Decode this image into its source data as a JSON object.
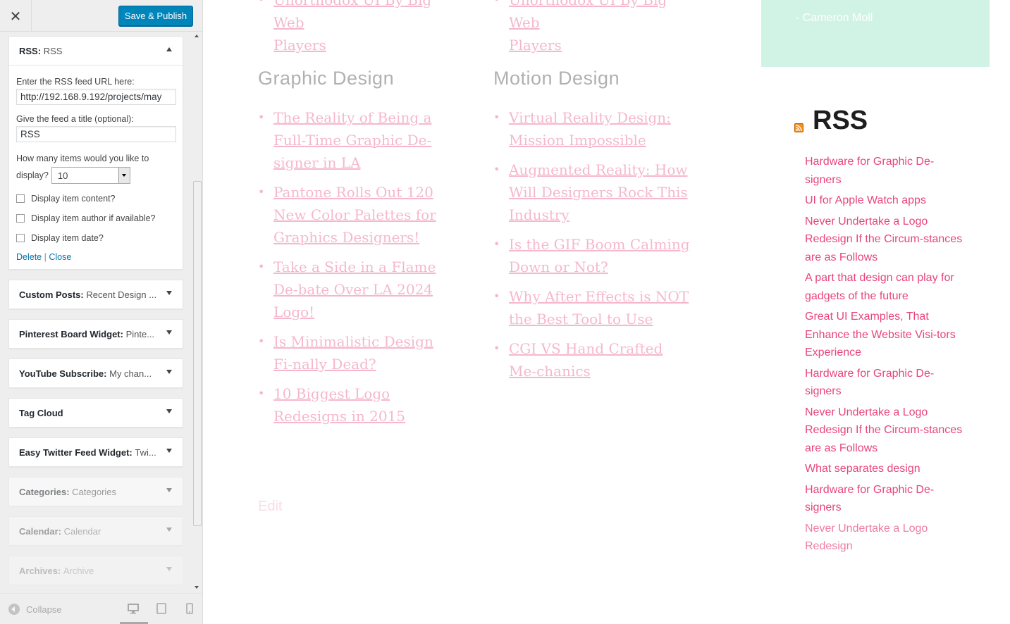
{
  "topbar": {
    "close_glyph": "✕",
    "save_label": "Save & Publish"
  },
  "rss_widget": {
    "title": "RSS",
    "title_sub": "RSS",
    "url_label": "Enter the RSS feed URL here:",
    "url_value": "http://192.168.9.192/projects/may",
    "title_label": "Give the feed a title (optional):",
    "title_value": "RSS",
    "items_label_1": "How many items would you like to",
    "items_label_2": "display?",
    "items_value": "10",
    "opt_content": "Display item content?",
    "opt_author": "Display item author if available?",
    "opt_date": "Display item date?",
    "delete": "Delete",
    "sep": "|",
    "close": "Close"
  },
  "widgets": [
    {
      "name": "Custom Posts:",
      "sub": "Recent Design ..."
    },
    {
      "name": "Pinterest Board Widget:",
      "sub": "Pinte..."
    },
    {
      "name": "YouTube Subscribe:",
      "sub": "My chan..."
    },
    {
      "name": "Tag Cloud",
      "sub": ""
    },
    {
      "name": "Easy Twitter Feed Widget:",
      "sub": "Twi..."
    },
    {
      "name": "Categories:",
      "sub": "Categories"
    },
    {
      "name": "Calendar:",
      "sub": "Calendar"
    },
    {
      "name": "Archives:",
      "sub": "Archive"
    }
  ],
  "footer": {
    "collapse": "Collapse"
  },
  "preview": {
    "top_left_link": [
      "Unorthodox UI By Big Web",
      "Players"
    ],
    "top_right_link": [
      "Unorthodox UI By Big Web",
      "Players"
    ],
    "graphic": {
      "heading": "Graphic Design",
      "items": [
        "The Reality of Being a Full-Time Graphic De-signer in LA",
        "Pantone Rolls Out 120 New Color Palettes for Graphics Designers!",
        "Take a Side in a Flame De-bate Over LA 2024 Logo!",
        "Is Minimalistic Design Fi-nally Dead?",
        "10 Biggest Logo Redesigns in 2015"
      ]
    },
    "motion": {
      "heading": "Motion Design",
      "items": [
        "Virtual Reality Design: Mission Impossible",
        "Augmented Reality: How Will Designers Rock This Industry",
        "Is the GIF Boom Calming Down or Not?",
        "Why After Effects is NOT the Best Tool to Use",
        "CGI VS Hand Crafted Me-chanics"
      ]
    },
    "edit": "Edit",
    "quote_author": "- Cameron Moll",
    "rss_title": "RSS",
    "rss_items": [
      "Hardware for Graphic De-signers",
      "UI for Apple Watch apps",
      "Never Undertake a Logo Redesign If the Circum-stances are as Follows",
      "A part that design can play for gadgets of the future",
      "Great UI Examples, That Enhance the Website Visi-tors Experience",
      "Hardware for Graphic De-signers",
      "Never Undertake a Logo Redesign If the Circum-stances are as Follows",
      "What separates design",
      "Hardware for Graphic De-signers",
      "Never Undertake a Logo Redesign"
    ]
  },
  "colors": {
    "accent": "#e7457e",
    "primary_button": "#0085ba",
    "mint": "#d1f3e6"
  }
}
